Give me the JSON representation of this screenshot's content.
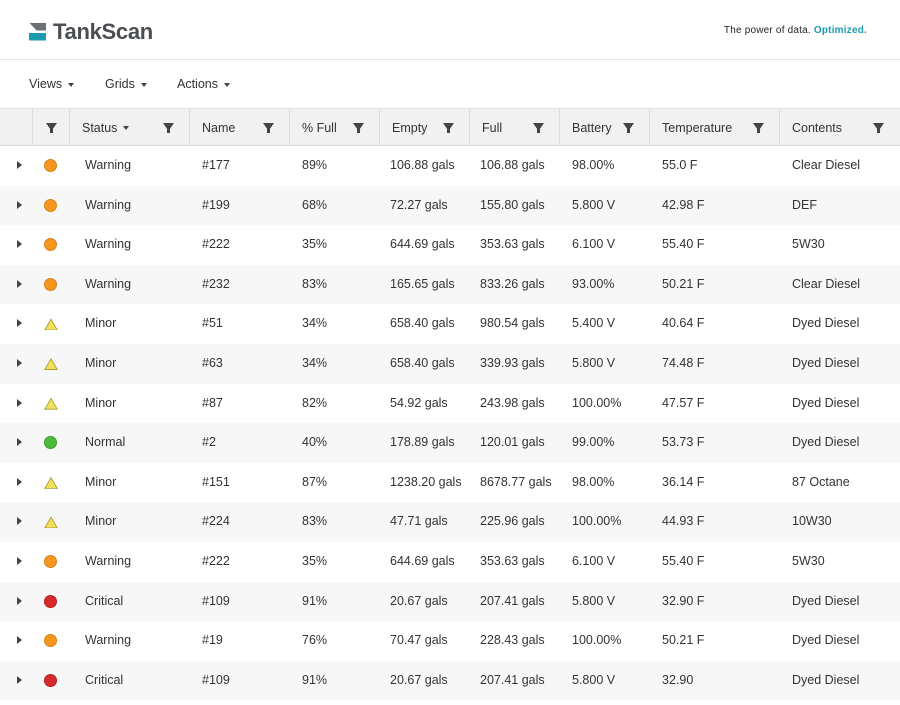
{
  "header": {
    "logo_text": "TankScan",
    "tagline_prefix": "The power of data.",
    "tagline_accent": "Optimized.",
    "accent_color": "#1a9bb0"
  },
  "toolbar": {
    "views_label": "Views",
    "grids_label": "Grids",
    "actions_label": "Actions"
  },
  "columns": {
    "status": "Status",
    "name": "Name",
    "pct_full": "% Full",
    "empty": "Empty",
    "full": "Full",
    "battery": "Battery",
    "temperature": "Temperature",
    "contents": "Contents"
  },
  "status_colors": {
    "warning": "#f5961f",
    "minor": "#f2e05a",
    "normal": "#4cbb3a",
    "critical": "#d62a2a"
  },
  "rows": [
    {
      "icon": "warning",
      "status": "Warning",
      "name": "#177",
      "pct_full": "89%",
      "empty": "106.88 gals",
      "full": "106.88 gals",
      "battery": "98.00%",
      "temperature": "55.0 F",
      "contents": "Clear Diesel"
    },
    {
      "icon": "warning",
      "status": "Warning",
      "name": "#199",
      "pct_full": "68%",
      "empty": "72.27 gals",
      "full": "155.80 gals",
      "battery": "5.800 V",
      "temperature": "42.98 F",
      "contents": "DEF"
    },
    {
      "icon": "warning",
      "status": "Warning",
      "name": "#222",
      "pct_full": "35%",
      "empty": "644.69 gals",
      "full": "353.63 gals",
      "battery": "6.100 V",
      "temperature": "55.40 F",
      "contents": "5W30"
    },
    {
      "icon": "warning",
      "status": "Warning",
      "name": "#232",
      "pct_full": "83%",
      "empty": "165.65 gals",
      "full": "833.26 gals",
      "battery": "93.00%",
      "temperature": "50.21 F",
      "contents": "Clear Diesel"
    },
    {
      "icon": "minor",
      "status": "Minor",
      "name": "#51",
      "pct_full": "34%",
      "empty": "658.40 gals",
      "full": "980.54 gals",
      "battery": "5.400 V",
      "temperature": "40.64 F",
      "contents": "Dyed Diesel"
    },
    {
      "icon": "minor",
      "status": "Minor",
      "name": "#63",
      "pct_full": "34%",
      "empty": "658.40 gals",
      "full": "339.93 gals",
      "battery": "5.800 V",
      "temperature": "74.48 F",
      "contents": "Dyed Diesel"
    },
    {
      "icon": "minor",
      "status": "Minor",
      "name": "#87",
      "pct_full": "82%",
      "empty": "54.92 gals",
      "full": "243.98 gals",
      "battery": "100.00%",
      "temperature": "47.57 F",
      "contents": "Dyed Diesel"
    },
    {
      "icon": "normal",
      "status": "Normal",
      "name": "#2",
      "pct_full": "40%",
      "empty": "178.89 gals",
      "full": "120.01 gals",
      "battery": "99.00%",
      "temperature": "53.73 F",
      "contents": "Dyed Diesel"
    },
    {
      "icon": "minor",
      "status": "Minor",
      "name": "#151",
      "pct_full": "87%",
      "empty": "1238.20 gals",
      "full": "8678.77 gals",
      "battery": "98.00%",
      "temperature": "36.14 F",
      "contents": "87 Octane"
    },
    {
      "icon": "minor",
      "status": "Minor",
      "name": "#224",
      "pct_full": "83%",
      "empty": "47.71 gals",
      "full": "225.96 gals",
      "battery": "100.00%",
      "temperature": "44.93 F",
      "contents": "10W30"
    },
    {
      "icon": "warning",
      "status": "Warning",
      "name": "#222",
      "pct_full": "35%",
      "empty": "644.69 gals",
      "full": "353.63 gals",
      "battery": "6.100 V",
      "temperature": "55.40 F",
      "contents": "5W30"
    },
    {
      "icon": "critical",
      "status": "Critical",
      "name": "#109",
      "pct_full": "91%",
      "empty": "20.67 gals",
      "full": "207.41 gals",
      "battery": "5.800 V",
      "temperature": "32.90 F",
      "contents": "Dyed Diesel"
    },
    {
      "icon": "warning",
      "status": "Warning",
      "name": "#19",
      "pct_full": "76%",
      "empty": "70.47 gals",
      "full": "228.43 gals",
      "battery": "100.00%",
      "temperature": "50.21 F",
      "contents": "Dyed Diesel"
    },
    {
      "icon": "critical",
      "status": "Critical",
      "name": "#109",
      "pct_full": "91%",
      "empty": "20.67 gals",
      "full": "207.41 gals",
      "battery": "5.800 V",
      "temperature": "32.90",
      "contents": "Dyed Diesel"
    }
  ]
}
